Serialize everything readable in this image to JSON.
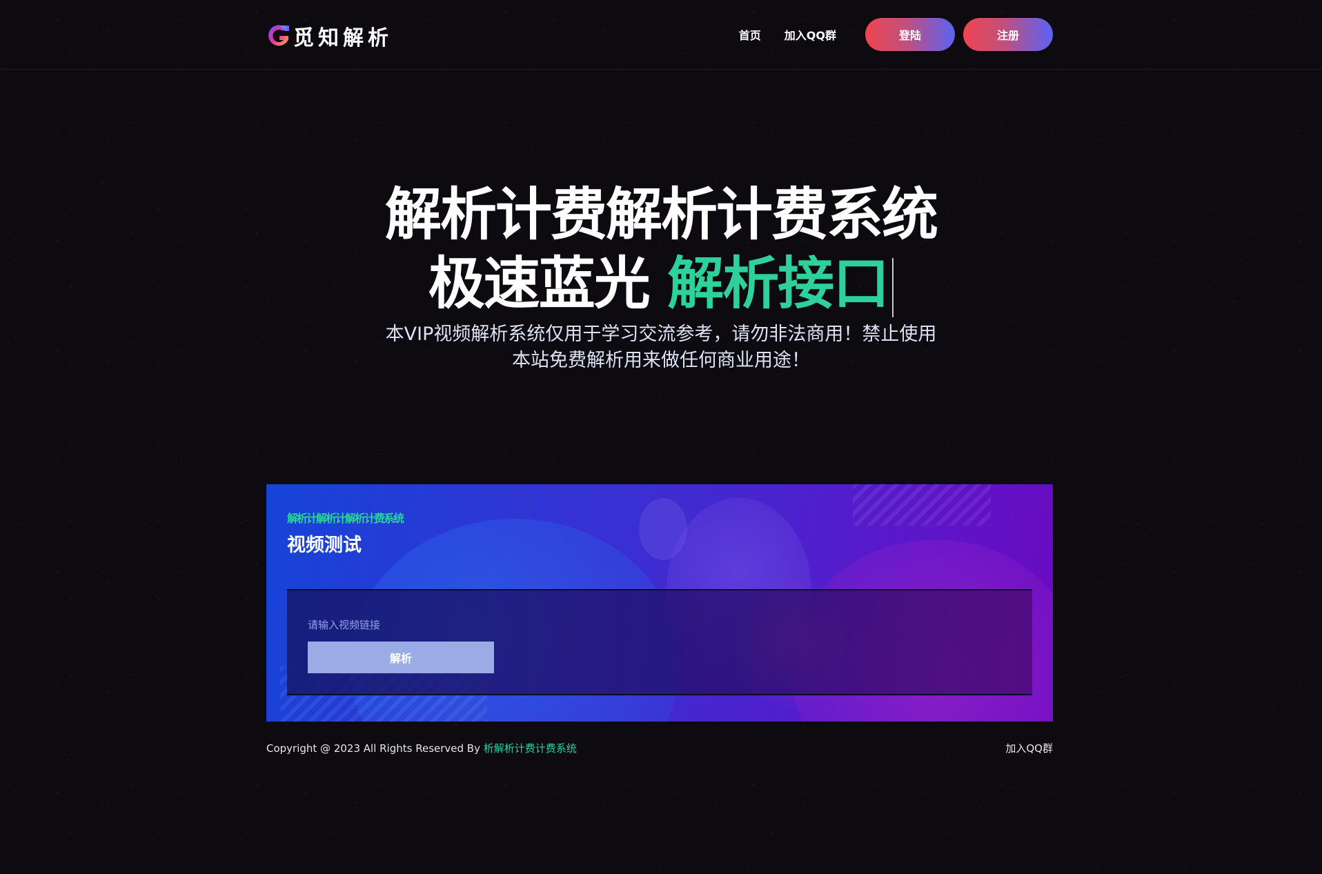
{
  "header": {
    "logo_text": "觅知解析",
    "logo_icon": "g-letter-logo-icon",
    "nav": [
      {
        "label": "首页"
      },
      {
        "label": "加入QQ群"
      }
    ],
    "login_button": "登陆",
    "register_button": "注册",
    "button_gradient": [
      "#ee4550",
      "#5b62f3"
    ]
  },
  "hero": {
    "line1": "解析计费解析计费系统",
    "line2_plain": "极速蓝光",
    "line2_accent": "解析接口",
    "accent_color": "#2ed19a",
    "description_line1": "本VIP视频解析系统仅用于学习交流参考，请勿非法商用！禁止使用",
    "description_line2": "本站免费解析用来做任何商业用途！"
  },
  "banner": {
    "subtitle": "解析计解析计解析计费系统",
    "title": "视频测试",
    "input_placeholder": "请输入视频链接",
    "input_value": "",
    "parse_button": "解析"
  },
  "footer": {
    "copyright": "Copyright @ 2023 All Rights Reserved By ",
    "site_link": "析解析计费计费系统",
    "qq_group_link": "加入QQ群"
  }
}
